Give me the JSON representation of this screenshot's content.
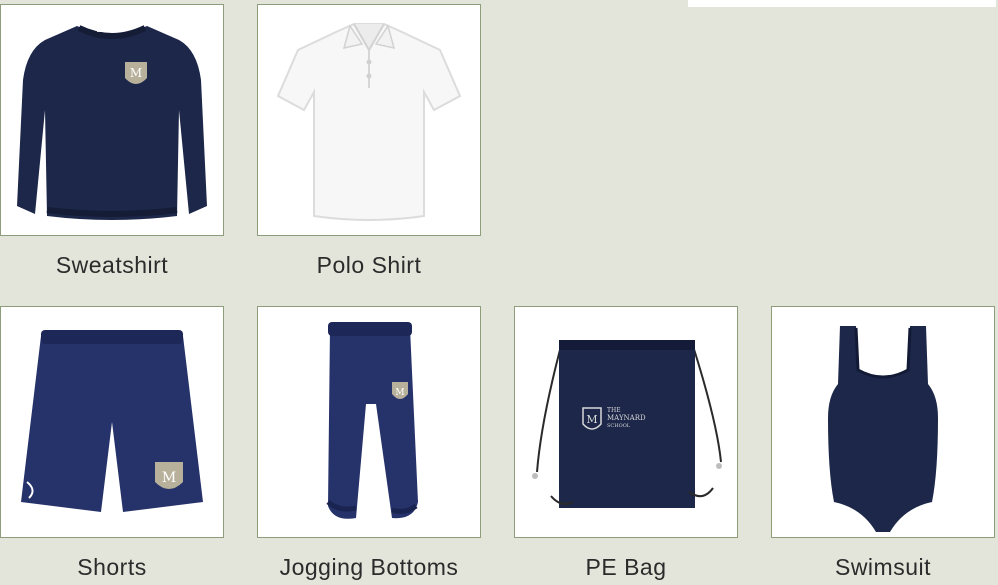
{
  "products": {
    "sweatshirt": {
      "label": "Sweatshirt",
      "image": "navy-crest-sweatshirt"
    },
    "polo_shirt": {
      "label": "Polo Shirt",
      "image": "white-polo-shirt"
    },
    "shorts": {
      "label": "Shorts",
      "image": "navy-crest-shorts"
    },
    "jogging_bottoms": {
      "label": "Jogging Bottoms",
      "image": "navy-crest-jogging-bottoms"
    },
    "pe_bag": {
      "label": "PE Bag",
      "image": "navy-drawstring-pe-bag"
    },
    "swimsuit": {
      "label": "Swimsuit",
      "image": "navy-swimsuit"
    }
  },
  "pe_bag_logo": {
    "monogram": "M",
    "line1": "THE",
    "line2": "MAYNARD",
    "line3": "SCHOOL"
  },
  "colors": {
    "page_background": "#e3e5da",
    "card_border": "#8d9d79",
    "navy": "#1c2749",
    "crest": "#b7b09a"
  }
}
